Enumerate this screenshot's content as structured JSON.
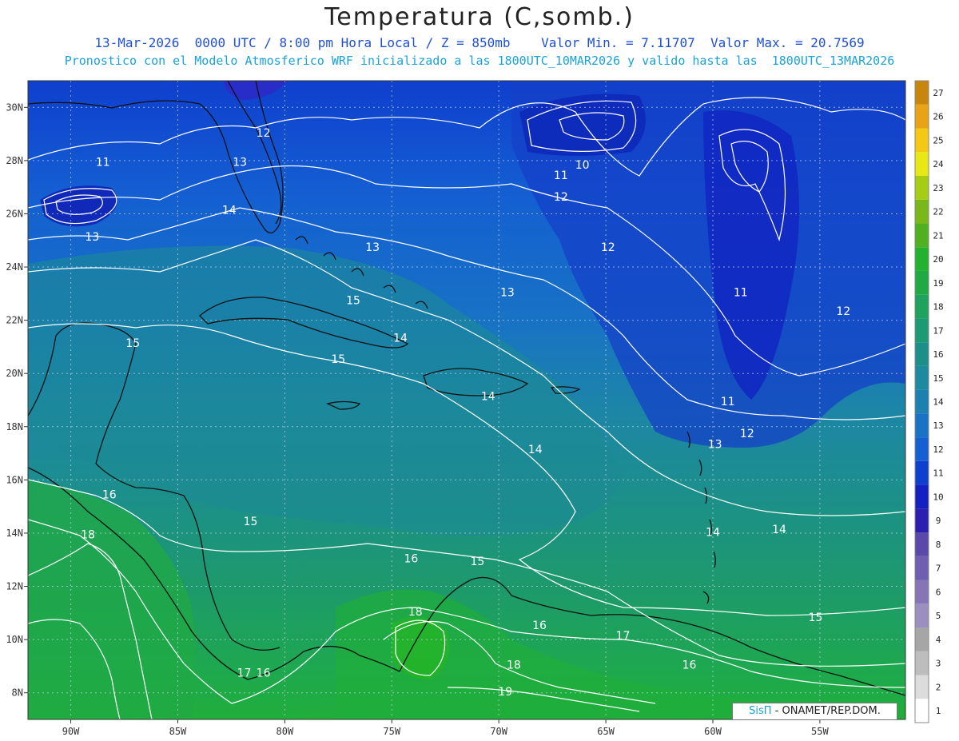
{
  "title": "Temperatura (C,somb.)",
  "subtitle_line1": "13-Mar-2026  0000 UTC / 8:00 pm Hora Local / Z = 850mb    Valor Min. = 7.11707  Valor Max. = 20.7569",
  "subtitle_line2": "Pronostico con el Modelo Atmosferico WRF inicializado a las 1800UTC_10MAR2026 y valido hasta las  1800UTC_13MAR2026",
  "credit_logo": "SisΠ",
  "credit_text": "- ONAMET/REP.DOM.",
  "map_data": {
    "lon_range": [
      -92,
      -51
    ],
    "lat_range": [
      7,
      31
    ],
    "lon_ticks": [
      "90W",
      "85W",
      "80W",
      "75W",
      "70W",
      "65W",
      "60W",
      "55W"
    ],
    "lat_ticks": [
      "8N",
      "10N",
      "12N",
      "14N",
      "16N",
      "18N",
      "20N",
      "22N",
      "24N",
      "26N",
      "28N",
      "30N"
    ],
    "grid": true,
    "contour_labels": [
      {
        "text": "11",
        "lon": -88.5,
        "lat": 27.8
      },
      {
        "text": "12",
        "lon": -81.0,
        "lat": 28.9
      },
      {
        "text": "13",
        "lon": -82.1,
        "lat": 27.8
      },
      {
        "text": "14",
        "lon": -82.6,
        "lat": 26.0
      },
      {
        "text": "13",
        "lon": -89.0,
        "lat": 25.0
      },
      {
        "text": "10",
        "lon": -66.1,
        "lat": 27.7
      },
      {
        "text": "11",
        "lon": -67.1,
        "lat": 27.3
      },
      {
        "text": "12",
        "lon": -67.1,
        "lat": 26.5
      },
      {
        "text": "13",
        "lon": -75.9,
        "lat": 24.6
      },
      {
        "text": "12",
        "lon": -64.9,
        "lat": 24.6
      },
      {
        "text": "13",
        "lon": -69.6,
        "lat": 22.9
      },
      {
        "text": "11",
        "lon": -58.7,
        "lat": 22.9
      },
      {
        "text": "12",
        "lon": -53.9,
        "lat": 22.2
      },
      {
        "text": "15",
        "lon": -76.8,
        "lat": 22.6
      },
      {
        "text": "14",
        "lon": -74.6,
        "lat": 21.2
      },
      {
        "text": "15",
        "lon": -87.1,
        "lat": 21.0
      },
      {
        "text": "15",
        "lon": -77.5,
        "lat": 20.4
      },
      {
        "text": "14",
        "lon": -70.5,
        "lat": 19.0
      },
      {
        "text": "11",
        "lon": -59.3,
        "lat": 18.8
      },
      {
        "text": "12",
        "lon": -58.4,
        "lat": 17.6
      },
      {
        "text": "13",
        "lon": -59.9,
        "lat": 17.2
      },
      {
        "text": "14",
        "lon": -68.3,
        "lat": 17.0
      },
      {
        "text": "16",
        "lon": -88.2,
        "lat": 15.3
      },
      {
        "text": "15",
        "lon": -81.6,
        "lat": 14.3
      },
      {
        "text": "18",
        "lon": -89.2,
        "lat": 13.8
      },
      {
        "text": "14",
        "lon": -60.0,
        "lat": 13.9
      },
      {
        "text": "14",
        "lon": -56.9,
        "lat": 14.0
      },
      {
        "text": "16",
        "lon": -74.1,
        "lat": 12.9
      },
      {
        "text": "15",
        "lon": -71.0,
        "lat": 12.8
      },
      {
        "text": "18",
        "lon": -73.9,
        "lat": 10.9
      },
      {
        "text": "16",
        "lon": -68.1,
        "lat": 10.4
      },
      {
        "text": "17",
        "lon": -64.2,
        "lat": 10.0
      },
      {
        "text": "15",
        "lon": -55.2,
        "lat": 10.7
      },
      {
        "text": "18",
        "lon": -69.3,
        "lat": 8.9
      },
      {
        "text": "16",
        "lon": -61.1,
        "lat": 8.9
      },
      {
        "text": "17",
        "lon": -81.9,
        "lat": 8.6
      },
      {
        "text": "16",
        "lon": -81.0,
        "lat": 8.6
      },
      {
        "text": "19",
        "lon": -69.7,
        "lat": 7.9
      }
    ],
    "colorbar": {
      "labels": [
        "1",
        "2",
        "3",
        "4",
        "5",
        "6",
        "7",
        "8",
        "9",
        "10",
        "11",
        "12",
        "13",
        "14",
        "15",
        "16",
        "17",
        "18",
        "19",
        "20",
        "21",
        "22",
        "23",
        "24",
        "25",
        "26",
        "27"
      ],
      "colors": [
        "#ffffff",
        "#dcdcdc",
        "#bdbdbd",
        "#a6a6a6",
        "#9a8fbf",
        "#8575b6",
        "#6f5fb0",
        "#5a49a8",
        "#2a1fb0",
        "#1420c0",
        "#0f3fce",
        "#145fd2",
        "#1873c4",
        "#1c80b0",
        "#1d8aa0",
        "#1c9088",
        "#1d9a72",
        "#1ea25e",
        "#1faa44",
        "#22b230",
        "#50b020",
        "#7ab81a",
        "#a8cc14",
        "#e8e814",
        "#f4c814",
        "#e8a414",
        "#c8860c"
      ]
    }
  }
}
